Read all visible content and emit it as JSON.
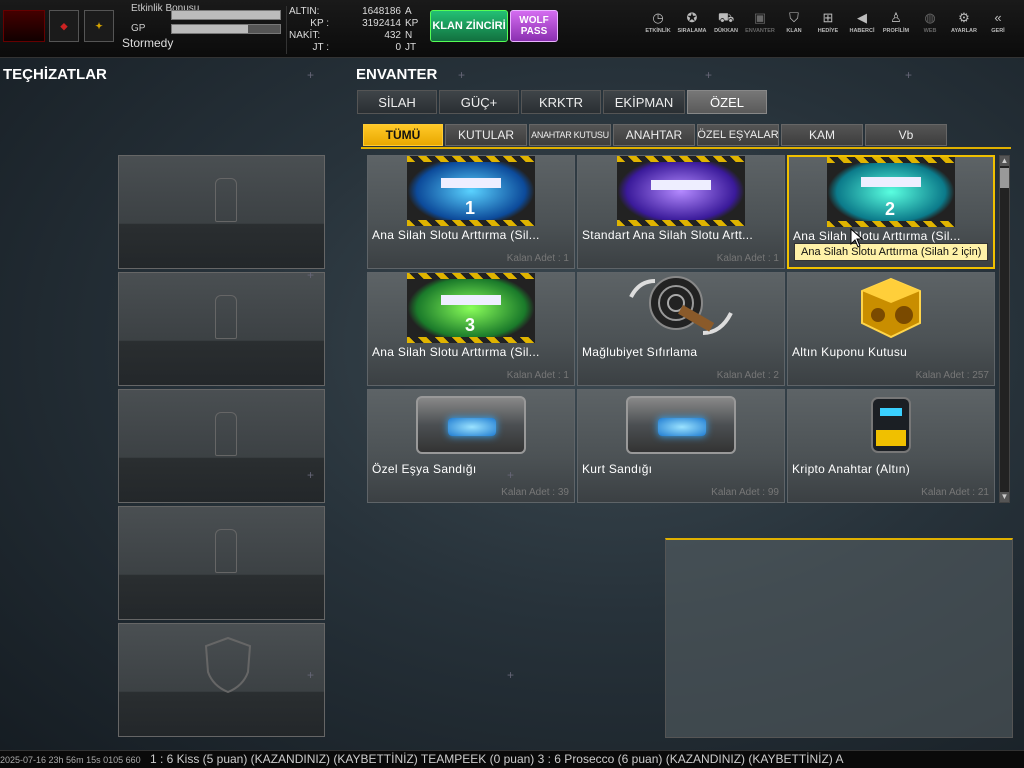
{
  "topbar": {
    "event_bonus_label": "Etkinlik Bonusu",
    "event_bonus_fill": 1.0,
    "gp_label": "GP",
    "gp_fill": 0.7,
    "username": "Stormedy",
    "currencies": [
      {
        "label": "ALTIN:",
        "value": "1648186",
        "unit": "A"
      },
      {
        "label": "KP :",
        "value": "3192414",
        "unit": "KP"
      },
      {
        "label": "NAKİT:",
        "value": "432",
        "unit": "N"
      },
      {
        "label": "JT :",
        "value": "0",
        "unit": "JT"
      }
    ],
    "klan_button": "KLAN ZİNCİRİ",
    "wolf_pass": "WOLF PASS",
    "nav": [
      {
        "label": "ETKİNLİK",
        "icon": "stopwatch-icon",
        "glyph": "◷"
      },
      {
        "label": "SIRALAMA",
        "icon": "medal-icon",
        "glyph": "✪"
      },
      {
        "label": "DÜKKAN",
        "icon": "cart-icon",
        "glyph": "⛟"
      },
      {
        "label": "ENVANTER",
        "icon": "inventory-icon",
        "glyph": "▣"
      },
      {
        "label": "KLAN",
        "icon": "shield-icon",
        "glyph": "⛉"
      },
      {
        "label": "HEDİYE",
        "icon": "gift-icon",
        "glyph": "⊞"
      },
      {
        "label": "HABERCİ",
        "icon": "megaphone-icon",
        "glyph": "◀"
      },
      {
        "label": "PROFİLİM",
        "icon": "profile-icon",
        "glyph": "♙"
      },
      {
        "label": "WEB",
        "icon": "globe-icon",
        "glyph": "◍"
      },
      {
        "label": "AYARLAR",
        "icon": "gear-icon",
        "glyph": "⚙"
      },
      {
        "label": "GERİ",
        "icon": "back-icon",
        "glyph": "«"
      }
    ]
  },
  "equipment": {
    "title": "TEÇHİZATLAR"
  },
  "inventory": {
    "title": "ENVANTER",
    "tabs": [
      "SİLAH",
      "GÜÇ+",
      "KRKTR",
      "EKİPMAN",
      "ÖZEL"
    ],
    "active_tab": 4,
    "subtabs": [
      "TÜMÜ",
      "KUTULAR",
      "ANAHTAR KUTUSU",
      "ANAHTAR",
      "ÖZEL EŞYALAR",
      "KAM",
      "Vb"
    ],
    "active_subtab": 0,
    "items": [
      {
        "name": "Ana Silah Slotu Arttırma (Sil...",
        "qty": "Kalan Adet : 1",
        "num": "1"
      },
      {
        "name": "Standart Ana Silah Slotu Artt...",
        "qty": "Kalan Adet : 1",
        "num": ""
      },
      {
        "name": "Ana Silah Slotu Arttırma (Sil...",
        "qty": "Kalan Adet : 1",
        "num": "2"
      },
      {
        "name": "Ana Silah Slotu Arttırma (Sil...",
        "qty": "Kalan Adet : 1",
        "num": "3"
      },
      {
        "name": "Mağlubiyet  Sıfırlama",
        "qty": "Kalan Adet : 2"
      },
      {
        "name": "Altın Kuponu Kutusu",
        "qty": "Kalan Adet : 257"
      },
      {
        "name": "Özel Eşya Sandığı",
        "qty": "Kalan Adet : 39"
      },
      {
        "name": "Kurt Sandığı",
        "qty": "Kalan Adet : 99"
      },
      {
        "name": "Kripto Anahtar (Altın)",
        "qty": "Kalan Adet : 21"
      }
    ],
    "tooltip": "Ana Silah Slotu Arttırma (Silah 2 için)"
  },
  "ticker": {
    "timestamp": "2025-07-16 23h 56m 15s 0105 660",
    "text": "1 : 6 Kiss (5 puan) (KAZANDINIZ)        (KAYBETTİNİZ) TEAMPEEK (0 puan) 3 : 6 Prosecco (6 puan) (KAZANDINIZ)        (KAYBETTİNİZ) A"
  },
  "colors": {
    "accent": "#f0c000",
    "klan": "#1a9a5a",
    "wolf": "#b04ad0"
  }
}
